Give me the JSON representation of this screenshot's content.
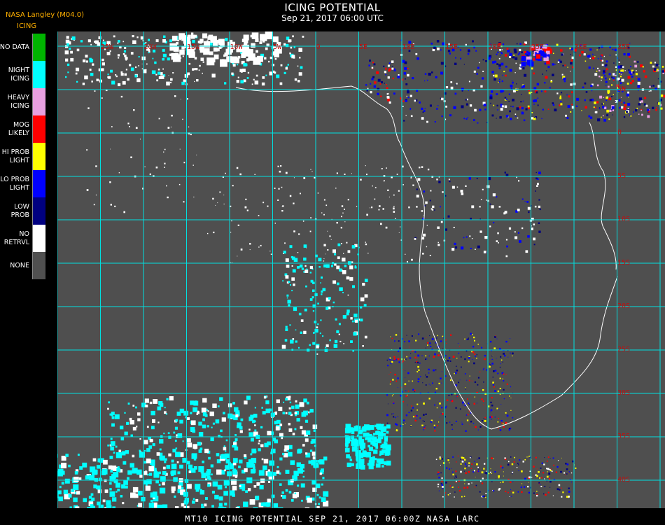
{
  "header": {
    "title": "ICING POTENTIAL",
    "subtitle": "Sep 21, 2017 06:00 UTC",
    "credit": "NASA Langley (M04.0)",
    "legend_title": "ICING"
  },
  "legend": [
    {
      "label": "NO DATA",
      "color": "#00b400"
    },
    {
      "label": "NIGHT\nICING",
      "color": "#00ffff"
    },
    {
      "label": "HEAVY\nICING",
      "color": "#e8a0e0"
    },
    {
      "label": "MOG\nLIKELY",
      "color": "#ff0000"
    },
    {
      "label": "HI PROB\nLIGHT",
      "color": "#ffff00"
    },
    {
      "label": "LO PROB\nLIGHT",
      "color": "#0000ff"
    },
    {
      "label": "LOW\nPROB",
      "color": "#000080"
    },
    {
      "label": "NO\nRETRVL",
      "color": "#ffffff"
    },
    {
      "label": "NONE",
      "color": "#505050"
    }
  ],
  "map": {
    "background": "#4f4f4f",
    "grid_color": "#00e0e0",
    "label_color": "#c01010",
    "lon_labels": [
      "25W",
      "20W",
      "15W",
      "10W",
      "5W",
      "0",
      "5E",
      "10E",
      "15E",
      "20E",
      "25E",
      "30E",
      "35E"
    ],
    "lat_labels": [
      "5N",
      "0",
      "5S",
      "10S",
      "15S",
      "20S",
      "25S",
      "30S",
      "35S",
      "40S"
    ]
  },
  "footer": {
    "caption": "MT10  ICING POTENTIAL   SEP 21, 2017 06:00Z   NASA LARC"
  }
}
